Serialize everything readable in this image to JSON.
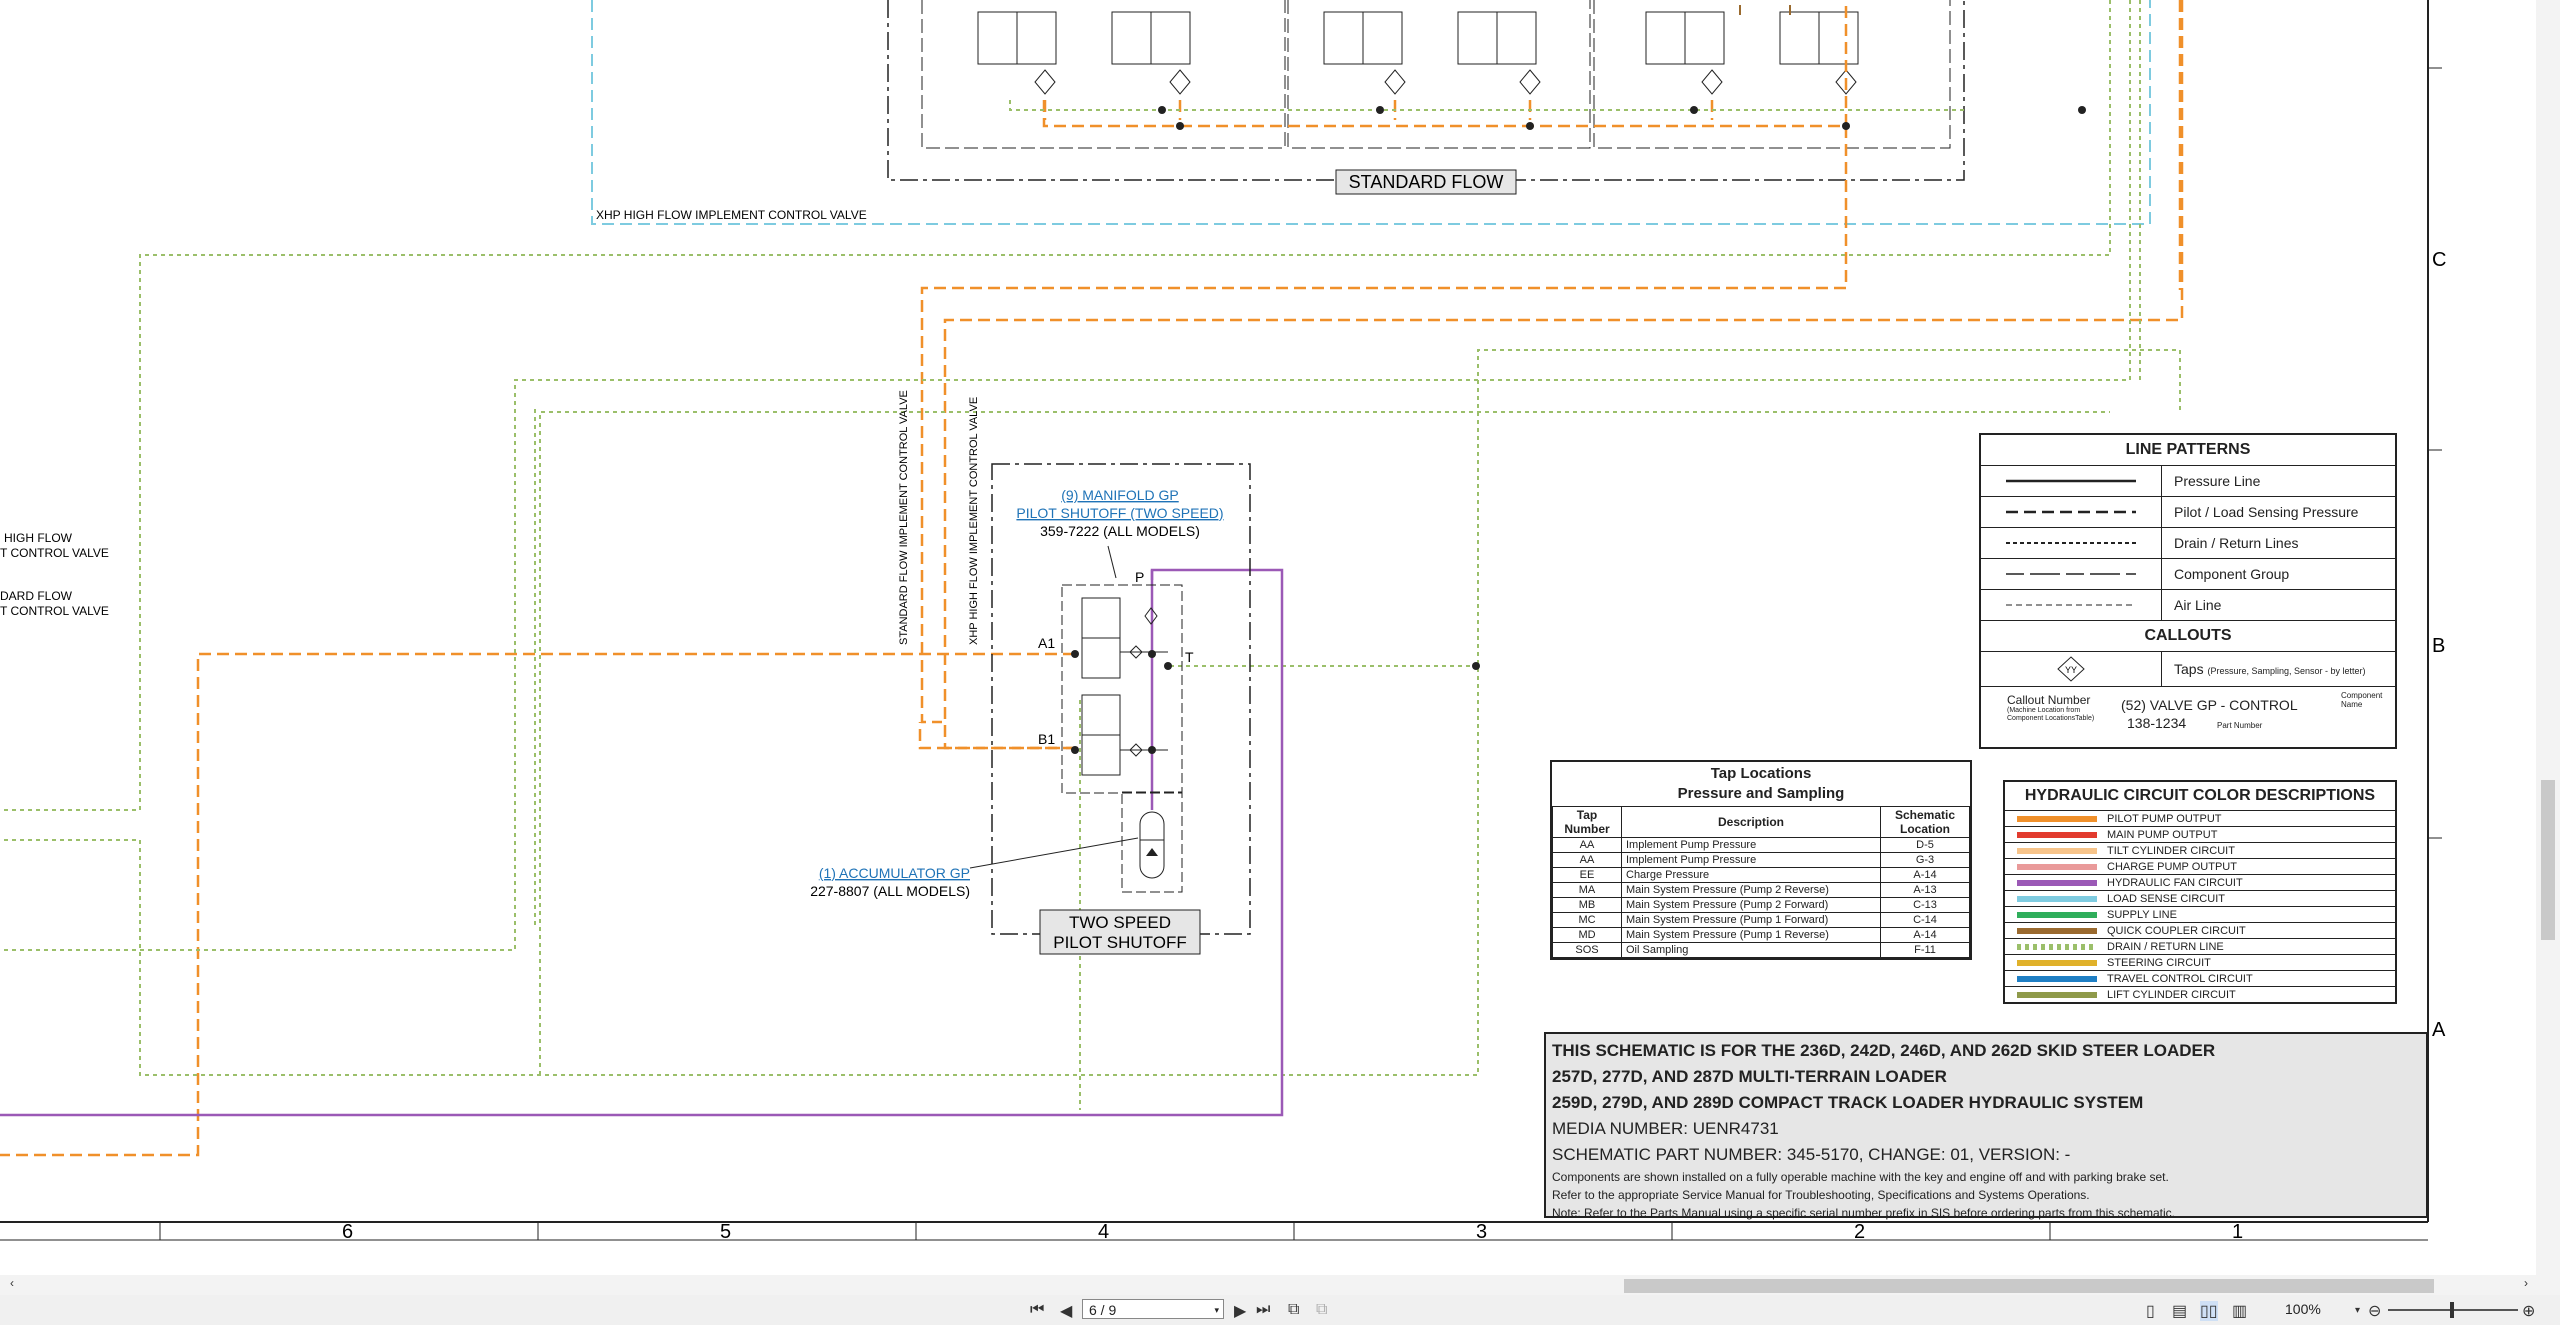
{
  "schematic": {
    "flow_label": "STANDARD FLOW",
    "xhp_label": "XHP HIGH FLOW IMPLEMENT CONTROL VALVE",
    "left_labels": [
      "HIGH FLOW",
      "T CONTROL VALVE",
      "DARD FLOW",
      "T CONTROL VALVE"
    ],
    "vertical_label_1": "STANDARD FLOW IMPLEMENT CONTROL VALVE",
    "vertical_label_2": "XHP HIGH FLOW IMPLEMENT CONTROL VALVE",
    "manifold": {
      "title_line1": "(9) MANIFOLD GP",
      "title_line2": "PILOT SHUTOFF (TWO SPEED)",
      "part": "359-7222 (ALL MODELS)",
      "port_p": "P",
      "port_t": "T",
      "port_a1": "A1",
      "port_b1": "B1",
      "box_label_line1": "TWO SPEED",
      "box_label_line2": "PILOT SHUTOFF"
    },
    "accumulator": {
      "title": "(1) ACCUMULATOR GP",
      "part": "227-8807 (ALL MODELS)"
    },
    "grid_rows": [
      "C",
      "B",
      "A"
    ],
    "grid_columns": [
      "6",
      "5",
      "4",
      "3",
      "2",
      "1"
    ]
  },
  "line_patterns": {
    "title": "LINE PATTERNS",
    "items": [
      "Pressure Line",
      "Pilot / Load Sensing Pressure",
      "Drain / Return Lines",
      "Component Group",
      "Air Line"
    ],
    "callouts_title": "CALLOUTS",
    "taps_label": "Taps",
    "taps_note": "(Pressure, Sampling, Sensor - by letter)",
    "taps_symbol": "YY",
    "callout_number_label": "Callout Number",
    "callout_number_note": "(Machine Location from Component LocationsTable)",
    "callout_example": "(52) VALVE GP - CONTROL",
    "component_name_label": "Component Name",
    "part_example": "138-1234",
    "part_number_label": "Part Number"
  },
  "tap_locations": {
    "title_line1": "Tap Locations",
    "title_line2": "Pressure and Sampling",
    "headers": [
      "Tap Number",
      "Description",
      "Schematic Location"
    ],
    "rows": [
      [
        "AA",
        "Implement Pump Pressure",
        "D-5"
      ],
      [
        "AA",
        "Implement Pump Pressure",
        "G-3"
      ],
      [
        "EE",
        "Charge Pressure",
        "A-14"
      ],
      [
        "MA",
        "Main System Pressure (Pump 2 Reverse)",
        "A-13"
      ],
      [
        "MB",
        "Main System Pressure (Pump 2 Forward)",
        "C-13"
      ],
      [
        "MC",
        "Main System Pressure (Pump 1 Forward)",
        "C-14"
      ],
      [
        "MD",
        "Main System Pressure (Pump 1 Reverse)",
        "A-14"
      ],
      [
        "SOS",
        "Oil Sampling",
        "F-11"
      ]
    ]
  },
  "color_descriptions": {
    "title": "HYDRAULIC CIRCUIT COLOR DESCRIPTIONS",
    "items": [
      {
        "label": "PILOT PUMP OUTPUT",
        "color": "#f0902a"
      },
      {
        "label": "MAIN PUMP OUTPUT",
        "color": "#e23b2e"
      },
      {
        "label": "TILT CYLINDER CIRCUIT",
        "color": "#f7c48a"
      },
      {
        "label": "CHARGE PUMP OUTPUT",
        "color": "#e99a9a"
      },
      {
        "label": "HYDRAULIC FAN CIRCUIT",
        "color": "#9b59b6"
      },
      {
        "label": "LOAD SENSE CIRCUIT",
        "color": "#7ecbe0"
      },
      {
        "label": "SUPPLY LINE",
        "color": "#2fae5b"
      },
      {
        "label": "QUICK COUPLER CIRCUIT",
        "color": "#9a6a2f"
      },
      {
        "label": "DRAIN / RETURN LINE",
        "color": "#9bbf6a"
      },
      {
        "label": "STEERING CIRCUIT",
        "color": "#e0b12a"
      },
      {
        "label": "TRAVEL CONTROL CIRCUIT",
        "color": "#1f7fc4"
      },
      {
        "label": "LIFT CYLINDER CIRCUIT",
        "color": "#8f9a4a"
      }
    ]
  },
  "notes": {
    "line1": "THIS SCHEMATIC IS FOR THE 236D, 242D, 246D, AND 262D SKID STEER LOADER",
    "line2": "257D, 277D, AND 287D MULTI-TERRAIN LOADER",
    "line3": "259D, 279D, AND 289D COMPACT TRACK LOADER HYDRAULIC SYSTEM",
    "line4": "MEDIA NUMBER: UENR4731",
    "line5": "SCHEMATIC PART NUMBER: 345-5170, CHANGE: 01, VERSION: -",
    "line6": "Components are shown installed on a fully operable machine with the key and engine off and with parking brake set.",
    "line7": "Refer to the appropriate Service Manual for Troubleshooting, Specifications and Systems Operations.",
    "line8": "Note: Refer to the Parts Manual using a specific serial number prefix in SIS before ordering parts from this schematic."
  },
  "viewer": {
    "page_indicator": "6 / 9",
    "zoom": "100%"
  },
  "colors": {
    "pilot": "#f0902a",
    "drain": "#9bbf6a",
    "fan": "#9b59b6",
    "load_sense": "#7ecbe0",
    "quick_coupler": "#9a6a2f"
  }
}
